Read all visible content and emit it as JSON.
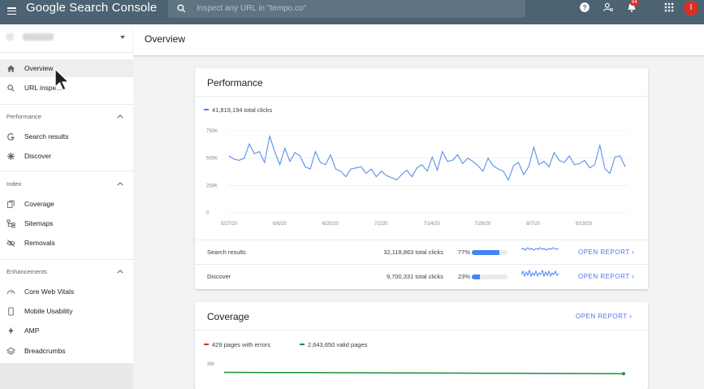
{
  "app": {
    "title": "Google Search Console",
    "search_placeholder": "Inspect any URL in \"tempo.co\"",
    "notification_count": "64",
    "avatar_initial": "I"
  },
  "sidebar": {
    "items_top": [
      {
        "label": "Overview",
        "icon": "home-icon",
        "active": true
      },
      {
        "label": "URL inspe...",
        "icon": "search-icon"
      }
    ],
    "sections": [
      {
        "title": "Performance",
        "items": [
          {
            "label": "Search results",
            "icon": "google-g-icon"
          },
          {
            "label": "Discover",
            "icon": "asterisk-icon"
          }
        ]
      },
      {
        "title": "Index",
        "items": [
          {
            "label": "Coverage",
            "icon": "file-copy-icon"
          },
          {
            "label": "Sitemaps",
            "icon": "sitemap-icon"
          },
          {
            "label": "Removals",
            "icon": "eye-off-icon"
          }
        ]
      },
      {
        "title": "Enhancements",
        "items": [
          {
            "label": "Core Web Vitals",
            "icon": "speed-gauge-icon"
          },
          {
            "label": "Mobile Usability",
            "icon": "smartphone-icon"
          },
          {
            "label": "AMP",
            "icon": "lightning-icon"
          },
          {
            "label": "Breadcrumbs",
            "icon": "layers-icon"
          }
        ]
      }
    ]
  },
  "main": {
    "title": "Overview",
    "performance": {
      "title": "Performance",
      "legend": "41,819,194 total clicks",
      "rows": [
        {
          "label": "Search results",
          "clicks": "32,118,863 total clicks",
          "pct": "77%",
          "fill": 0.77,
          "action": "OPEN REPORT"
        },
        {
          "label": "Discover",
          "clicks": "9,700,331 total clicks",
          "pct": "23%",
          "fill": 0.23,
          "action": "OPEN REPORT"
        }
      ]
    },
    "coverage": {
      "title": "Coverage",
      "action": "OPEN REPORT",
      "legend_errors": "429 pages with errors",
      "legend_valid": "2,643,650 valid pages",
      "y_tick": "3M"
    }
  },
  "colors": {
    "topbar": "#4b6372",
    "accent": "#4285f4",
    "link": "#4a7de8",
    "error": "#d93025",
    "valid": "#1e8e3e"
  },
  "chart_data": [
    {
      "type": "line",
      "title": "",
      "xlabel": "",
      "ylabel": "",
      "series": [
        {
          "name": "41,819,194 total clicks",
          "values": [
            520000,
            490000,
            480000,
            500000,
            630000,
            540000,
            560000,
            460000,
            700000,
            560000,
            440000,
            590000,
            470000,
            550000,
            520000,
            420000,
            400000,
            560000,
            460000,
            440000,
            530000,
            400000,
            380000,
            330000,
            400000,
            410000,
            420000,
            360000,
            400000,
            330000,
            380000,
            340000,
            320000,
            300000,
            350000,
            390000,
            330000,
            410000,
            440000,
            380000,
            510000,
            390000,
            560000,
            470000,
            480000,
            530000,
            450000,
            500000,
            470000,
            430000,
            380000,
            500000,
            430000,
            400000,
            380000,
            300000,
            430000,
            460000,
            350000,
            420000,
            600000,
            440000,
            470000,
            420000,
            550000,
            480000,
            460000,
            520000,
            440000,
            450000,
            480000,
            410000,
            440000,
            620000,
            400000,
            360000,
            510000,
            520000,
            420000
          ]
        }
      ],
      "x_ticks": [
        "5/27/20",
        "6/8/20",
        "6/20/20",
        "7/2/20",
        "7/14/20",
        "7/26/20",
        "8/7/20",
        "8/19/20"
      ],
      "y_ticks": [
        "0",
        "250K",
        "500K",
        "750K"
      ],
      "ylim": [
        0,
        750000
      ],
      "grid": true
    },
    {
      "type": "line",
      "title": "",
      "series": [
        {
          "name": "2,643,650 valid pages",
          "values": [
            2640000,
            2630000,
            2620000,
            2610000,
            2600000,
            2590000,
            2580000,
            2570000,
            2560000,
            2550000
          ]
        }
      ],
      "y_ticks": [
        "3M"
      ]
    }
  ]
}
